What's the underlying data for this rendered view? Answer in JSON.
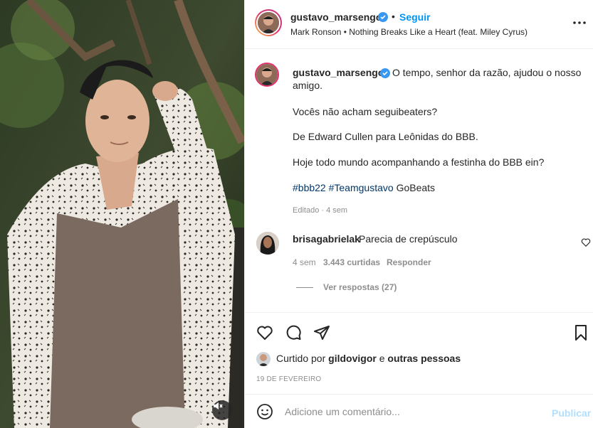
{
  "post": {
    "author": "gustavo_marsengo",
    "follow_label": "Seguir",
    "separator": "•",
    "music": "Mark Ronson • Nothing Breaks Like a Heart (feat. Miley Cyrus)",
    "more_icon": "more-horizontal-icon"
  },
  "caption": {
    "username": "gustavo_marsengo",
    "line1": "O tempo, senhor da razão, ajudou o nosso",
    "line1b": "amigo.",
    "line2": "Vocês não acham seguibeaters?",
    "line3": "De Edward Cullen para Leônidas do BBB.",
    "line4": "Hoje todo mundo acompanhando a festinha do BBB ein?",
    "hashtag1": "#bbb22",
    "hashtag2": "#Teamgustavo",
    "tail": "GoBeats",
    "edited": "Editado · 4 sem"
  },
  "comment": {
    "username": "brisagabrielak",
    "text": "Parecia de crepúsculo",
    "age": "4 sem",
    "likes": "3.443 curtidas",
    "reply": "Responder",
    "view_replies": "Ver respostas (27)"
  },
  "actions": {
    "liked_prefix": "Curtido por",
    "liked_user": "gildovigor",
    "liked_joiner": "e",
    "liked_others": "outras pessoas",
    "date": "19 DE FEVEREIRO"
  },
  "composer": {
    "placeholder": "Adicione um comentário...",
    "publish_label": "Publicar"
  },
  "colors": {
    "link_blue": "#0095f6",
    "hashtag": "#00376b",
    "muted": "#8e8e8e",
    "publish_disabled": "#b2dffc"
  }
}
